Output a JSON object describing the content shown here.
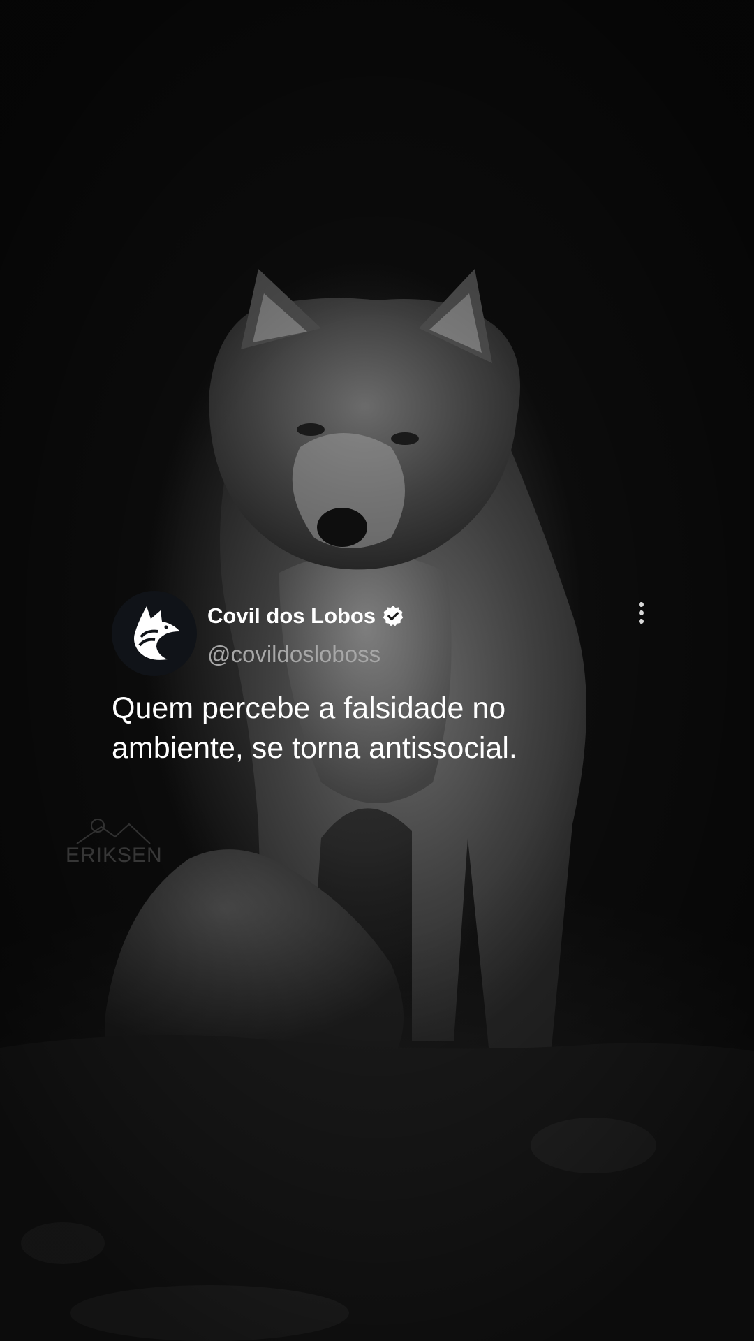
{
  "post": {
    "display_name": "Covil dos Lobos",
    "handle": "@covildosloboss",
    "verified": true,
    "text_lines": [
      "Quem percebe a falsidade no",
      "ambiente, se torna antissocial."
    ],
    "avatar_icon": "wolf-logo-icon",
    "more_icon": "more-vertical-icon"
  },
  "watermark": {
    "text": "ERIKSEN"
  },
  "colors": {
    "background": "#0e0e0e",
    "text_primary": "#ffffff",
    "text_secondary": "#a7a7a7",
    "avatar_bg": "#101318"
  }
}
